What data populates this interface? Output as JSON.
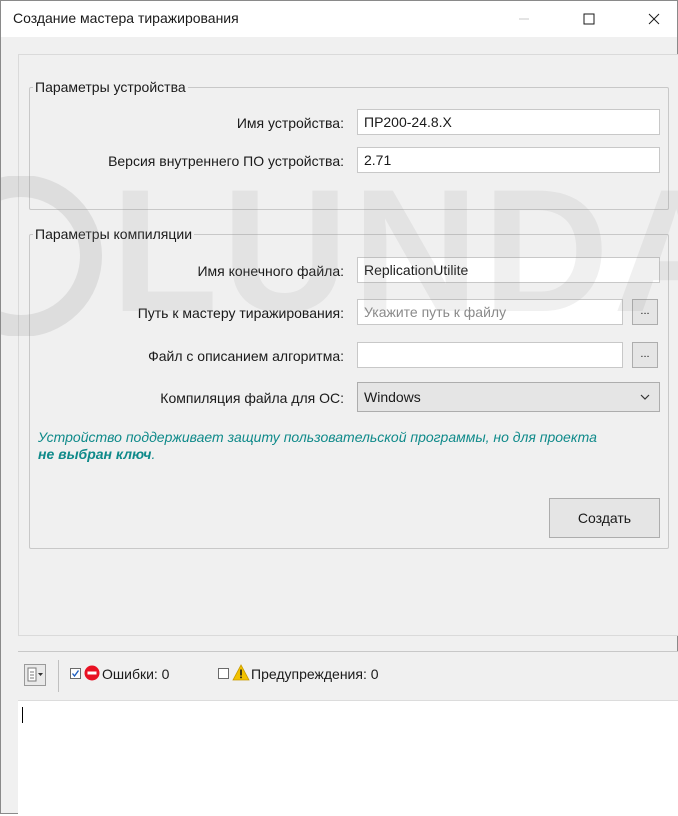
{
  "window": {
    "title": "Создание мастера тиражирования",
    "controls": [
      "minimize-icon",
      "maximize-icon",
      "close-icon"
    ]
  },
  "device_group": {
    "legend": "Параметры устройства",
    "device_name_label": "Имя устройства:",
    "device_name_value": "ПР200-24.8.Х",
    "firmware_label": "Версия внутреннего ПО устройства:",
    "firmware_value": "2.71"
  },
  "compile_group": {
    "legend": "Параметры компиляции",
    "output_file_label": "Имя конечного файла:",
    "output_file_value": "ReplicationUtilite",
    "wizard_path_label": "Путь к мастеру тиражирования:",
    "wizard_path_placeholder": "Укажите путь к файлу",
    "algorithm_file_label": "Файл с описанием алгоритма:",
    "algorithm_file_value": "",
    "browse_label": "...",
    "os_label": "Компиляция файла для ОС:",
    "os_value": "Windows",
    "notice_text": "Устройство поддерживает защиту пользовательской программы, но для проекта",
    "notice_bold": "не выбран ключ",
    "notice_end": ".",
    "create_button": "Создать"
  },
  "messages_panel": {
    "errors_checked": true,
    "errors_label": "Ошибки: 0",
    "warnings_checked": false,
    "warnings_label": "Предупреждения: 0",
    "log_text": ""
  },
  "watermark_text": "OLUNDA",
  "colors": {
    "notice": "#0f8a8a",
    "error_icon": "#e81123",
    "warning_icon": "#f2c200",
    "checkbox_mark": "#1f5fbf"
  }
}
